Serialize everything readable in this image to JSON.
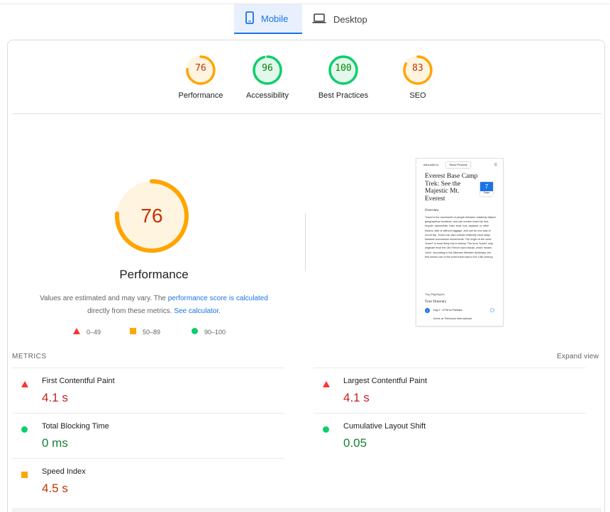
{
  "tabs": [
    {
      "label": "Mobile",
      "icon": "phone-icon",
      "selected": true
    },
    {
      "label": "Desktop",
      "icon": "laptop-icon",
      "selected": false
    }
  ],
  "gauges": [
    {
      "score": "76",
      "label": "Performance",
      "value": 0.76,
      "color": "#ffa400",
      "text_color": "#c33300"
    },
    {
      "score": "96",
      "label": "Accessibility",
      "value": 0.96,
      "color": "#0cce6b",
      "text_color": "#008800"
    },
    {
      "score": "100",
      "label": "Best Practices",
      "value": 1.0,
      "color": "#0cce6b",
      "text_color": "#008800"
    },
    {
      "score": "83",
      "label": "SEO",
      "value": 0.83,
      "color": "#ffa400",
      "text_color": "#c33300"
    }
  ],
  "performance": {
    "score": "76",
    "value": 0.76,
    "title": "Performance",
    "desc_1": "Values are estimated and may vary. The ",
    "desc_link_1": "performance score is calculated",
    "desc_2": " directly from these metrics. ",
    "desc_link_2": "See calculator.",
    "legend": [
      {
        "range": "0–49",
        "shape": "triangle",
        "color": "#ff3333"
      },
      {
        "range": "50–89",
        "shape": "square",
        "color": "#ffa400"
      },
      {
        "range": "90–100",
        "shape": "circle",
        "color": "#0cce6b"
      }
    ]
  },
  "screenshot": {
    "site": "mira-wild.co",
    "show_process": "Show Process",
    "title": "Everest Base Camp Trek: See the Majestic Mt. Everest",
    "badge_number": "7",
    "badge_label": "Days",
    "overview": "Overview",
    "body": "Travel is the movement of people between relatively distant geographical locations, and can involve travel by foot, bicycle, automobile, train, boat, bus, airplane, or other means, with or without luggage, and can be one way or round trip. Travel can also include relatively short stays between successive movements. The origin of the word \"travel\" is most likely lost to history. The term \"travel\" may originate from the Old French word travail, which means 'work'. According to the Merriam Webster dictionary, the first known use of the word travel was in the 14th century.",
    "highlights": "Trip Highlights",
    "itinerary": "Tour Itinerary",
    "day_label": "Day 1 : KTM to Pokhara",
    "day_number": "1",
    "arrive": "Arrive at Tribhuvan International"
  },
  "metrics": {
    "heading": "METRICS",
    "expand": "Expand view",
    "items": [
      {
        "label": "First Contentful Paint",
        "value": "4.1 s",
        "status": "red"
      },
      {
        "label": "Largest Contentful Paint",
        "value": "4.1 s",
        "status": "red"
      },
      {
        "label": "Total Blocking Time",
        "value": "0 ms",
        "status": "green"
      },
      {
        "label": "Cumulative Layout Shift",
        "value": "0.05",
        "status": "green"
      },
      {
        "label": "Speed Index",
        "value": "4.5 s",
        "status": "orange"
      }
    ]
  }
}
